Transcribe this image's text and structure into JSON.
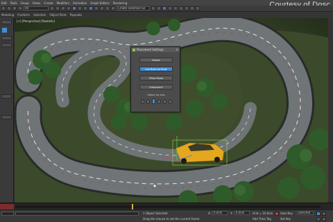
{
  "app": {
    "watermark": "Courtesy of Dosc"
  },
  "menubar": {
    "items": [
      "Edit",
      "Tools",
      "Group",
      "Views",
      "Create",
      "Modifiers",
      "Animation",
      "Graph Editors",
      "Rendering"
    ]
  },
  "toolbar": {
    "selection_filter": "All",
    "named_selection": "Create Selection Se"
  },
  "ribbon": {
    "items": [
      "Modeling",
      "Freeform",
      "Selection",
      "Object Paint",
      "Populate"
    ]
  },
  "viewport": {
    "label": "[+] [Perspective] [Realistic]"
  },
  "dialog": {
    "title": "Placement Settings",
    "close_icon": "close-icon",
    "buttons": [
      "Rotate",
      "Use Base As Pivot",
      "Pillow Mode",
      "Autoparent"
    ],
    "active_button_index": 1,
    "object_up_axis_label": "Object Up Axis"
  },
  "timeline": {
    "frame": "0 / 100"
  },
  "statusbar": {
    "selected": "1 Object Selected",
    "prompt": "Drag the mouse to set the current frame",
    "x_label": "X:",
    "x_value": "0.0cm",
    "y_label": "Y:",
    "y_value": "0.0cm",
    "grid_label": "Grid = 10.0cm",
    "add_time_tag": "Add Time Tag",
    "auto_key": "Auto Key",
    "key_mode": "Selected",
    "set_key": "Set Key"
  },
  "colors": {
    "accent_blue": "#3f8fd8",
    "road_asphalt": "#6f7476",
    "car_yellow": "#e3a81f",
    "foliage": "#2f5a2a"
  }
}
